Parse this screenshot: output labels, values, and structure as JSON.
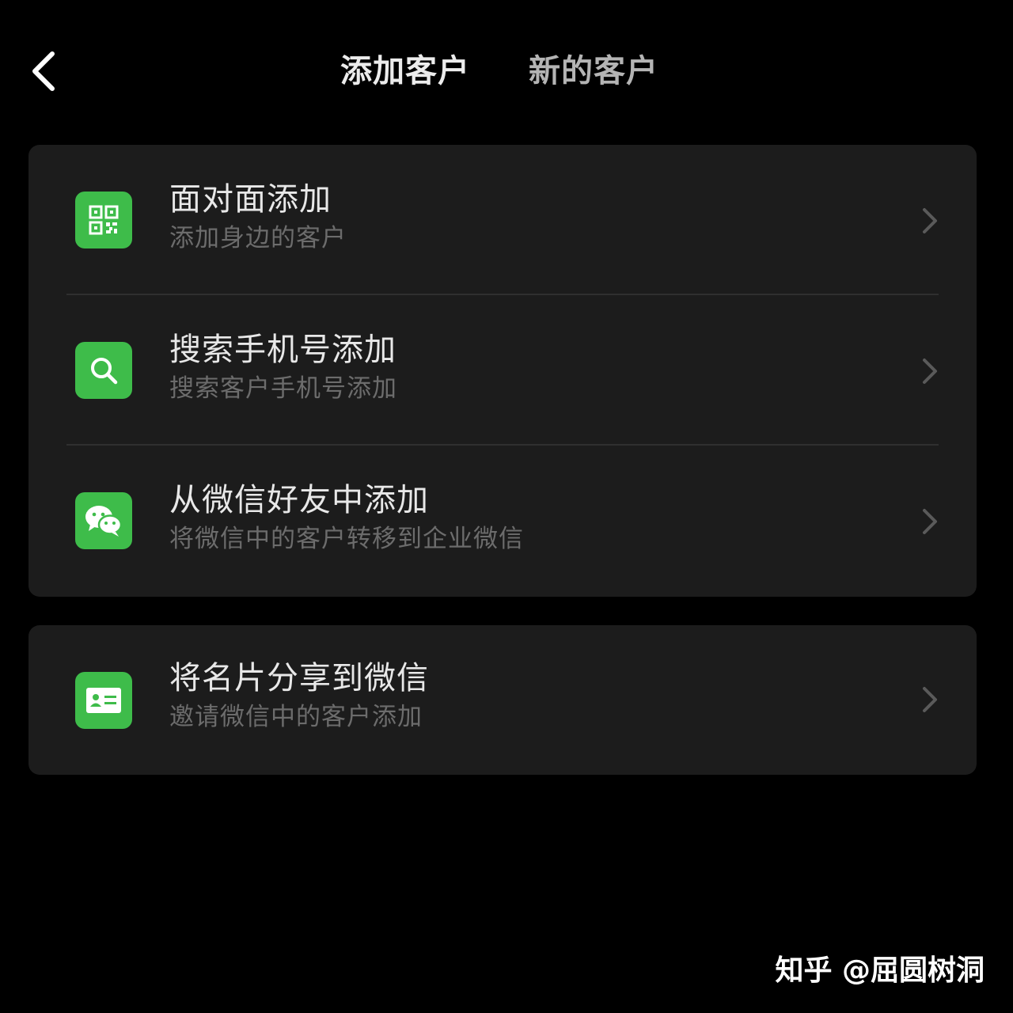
{
  "header": {
    "back_icon": "chevron-left-icon",
    "tabs": [
      {
        "label": "添加客户",
        "active": true
      },
      {
        "label": "新的客户",
        "active": false
      }
    ]
  },
  "sections": [
    {
      "items": [
        {
          "icon": "qr-code-icon",
          "title": "面对面添加",
          "subtitle": "添加身边的客户"
        },
        {
          "icon": "search-icon",
          "title": "搜索手机号添加",
          "subtitle": "搜索客户手机号添加"
        },
        {
          "icon": "wechat-icon",
          "title": "从微信好友中添加",
          "subtitle": "将微信中的客户转移到企业微信"
        }
      ]
    },
    {
      "items": [
        {
          "icon": "business-card-icon",
          "title": "将名片分享到微信",
          "subtitle": "邀请微信中的客户添加"
        }
      ]
    }
  ],
  "watermark": "知乎 @屈圆树洞",
  "colors": {
    "background": "#000000",
    "card": "#1c1c1c",
    "accent_green": "#3ebc4a",
    "title_text": "#e8e8e8",
    "subtitle_text": "#6c6c6c"
  }
}
